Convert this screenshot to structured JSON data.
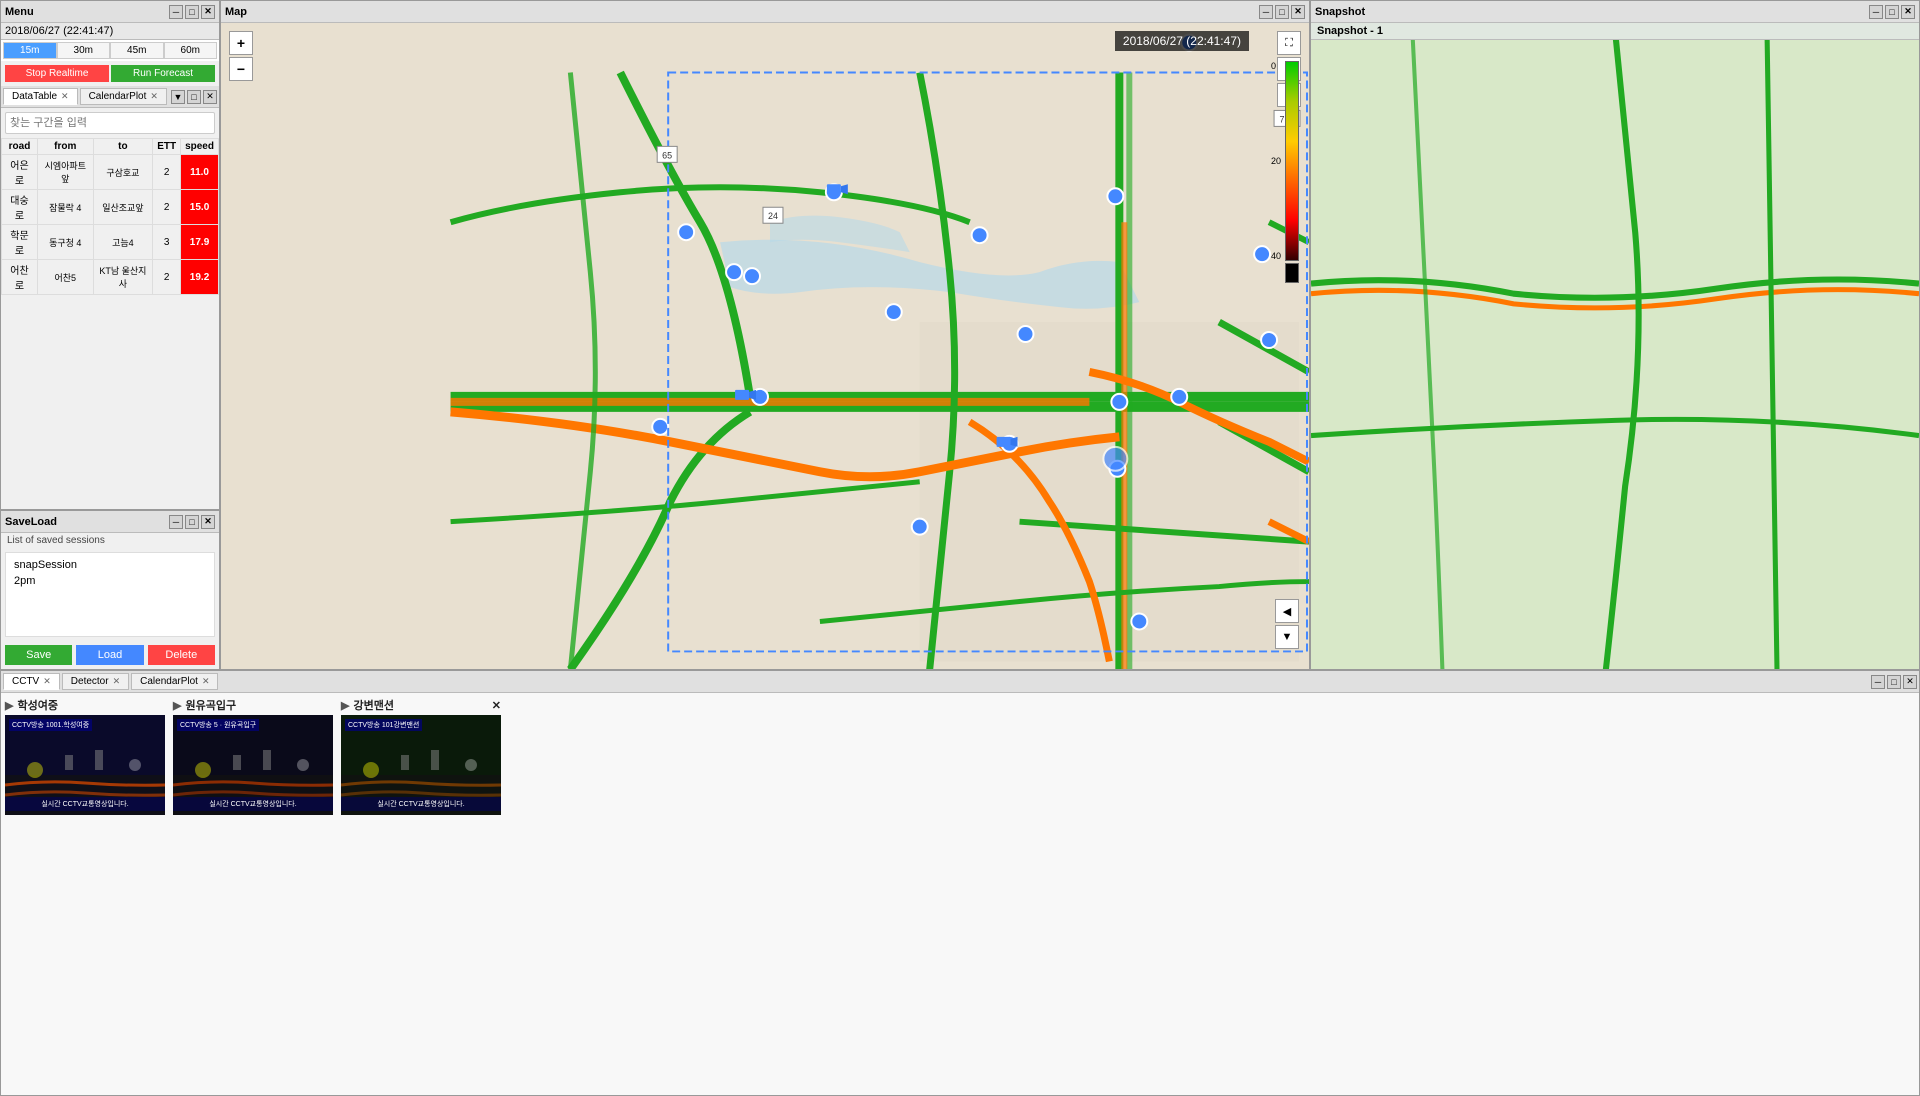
{
  "menu": {
    "title": "Menu",
    "timestamp": "2018/06/27 (22:41:47)",
    "times": [
      "15m",
      "30m",
      "45m",
      "60m"
    ],
    "active_time": "15m",
    "btn_stop": "Stop Realtime",
    "btn_forecast": "Run Forecast",
    "search_placeholder": "찾는 구간을 입력",
    "table": {
      "headers": [
        "road",
        "from",
        "to",
        "ETT",
        "speed"
      ],
      "rows": [
        {
          "road": "어은로",
          "from": "시엠아파트앞",
          "to": "구삼호교",
          "ett": "2",
          "speed": "11.0",
          "speed_level": "red"
        },
        {
          "road": "대숭로",
          "from": "잠물락 4",
          "to": "일산조교앞",
          "ett": "2",
          "speed": "15.0",
          "speed_level": "red"
        },
        {
          "road": "학문로",
          "from": "동구청 4",
          "to": "고늠4",
          "ett": "3",
          "speed": "17.9",
          "speed_level": "red"
        },
        {
          "road": "어찬로",
          "from": "어찬5",
          "to": "KT남 울산지사",
          "ett": "2",
          "speed": "19.2",
          "speed_level": "red"
        }
      ]
    },
    "tabs": [
      {
        "label": "DataTable",
        "active": true
      },
      {
        "label": "CalendarPlot",
        "active": false
      }
    ]
  },
  "map": {
    "title": "Map",
    "timestamp": "2018/06/27 (22:41:47)",
    "road_labels": [
      "65",
      "24",
      "7, 3"
    ],
    "zoom_plus": "+",
    "zoom_minus": "−"
  },
  "snapshot": {
    "title": "Snapshot",
    "subtitle": "Snapshot - 1"
  },
  "saveload": {
    "title": "SaveLoad",
    "list_label": "List of saved sessions",
    "sessions": [
      "snapSession",
      "2pm"
    ],
    "btn_save": "Save",
    "btn_load": "Load",
    "btn_delete": "Delete"
  },
  "bottom": {
    "tabs": [
      {
        "label": "CCTV",
        "active": true
      },
      {
        "label": "Detector",
        "active": false
      },
      {
        "label": "CalendarPlot",
        "active": false
      }
    ],
    "cctv_items": [
      {
        "location": "학성여중",
        "id": "1001.학성여중",
        "status": "실시간 CCTV교통영상입니다.",
        "has_close": false
      },
      {
        "location": "원유곡입구",
        "id": "5 · 원유곡입구",
        "status": "실시간 CCTV교통영상입니다.",
        "has_close": false
      },
      {
        "location": "강변맨션",
        "id": "101강변맨션",
        "status": "실시간 CCTV교통영상입니다.",
        "has_close": true
      }
    ]
  },
  "colors": {
    "accent_blue": "#4488ff",
    "speed_red": "#ff0000",
    "speed_orange": "#ff6600",
    "green_road": "#22aa22",
    "orange_road": "#ff8800",
    "btn_green": "#33aa33",
    "btn_red": "#ff4444"
  }
}
